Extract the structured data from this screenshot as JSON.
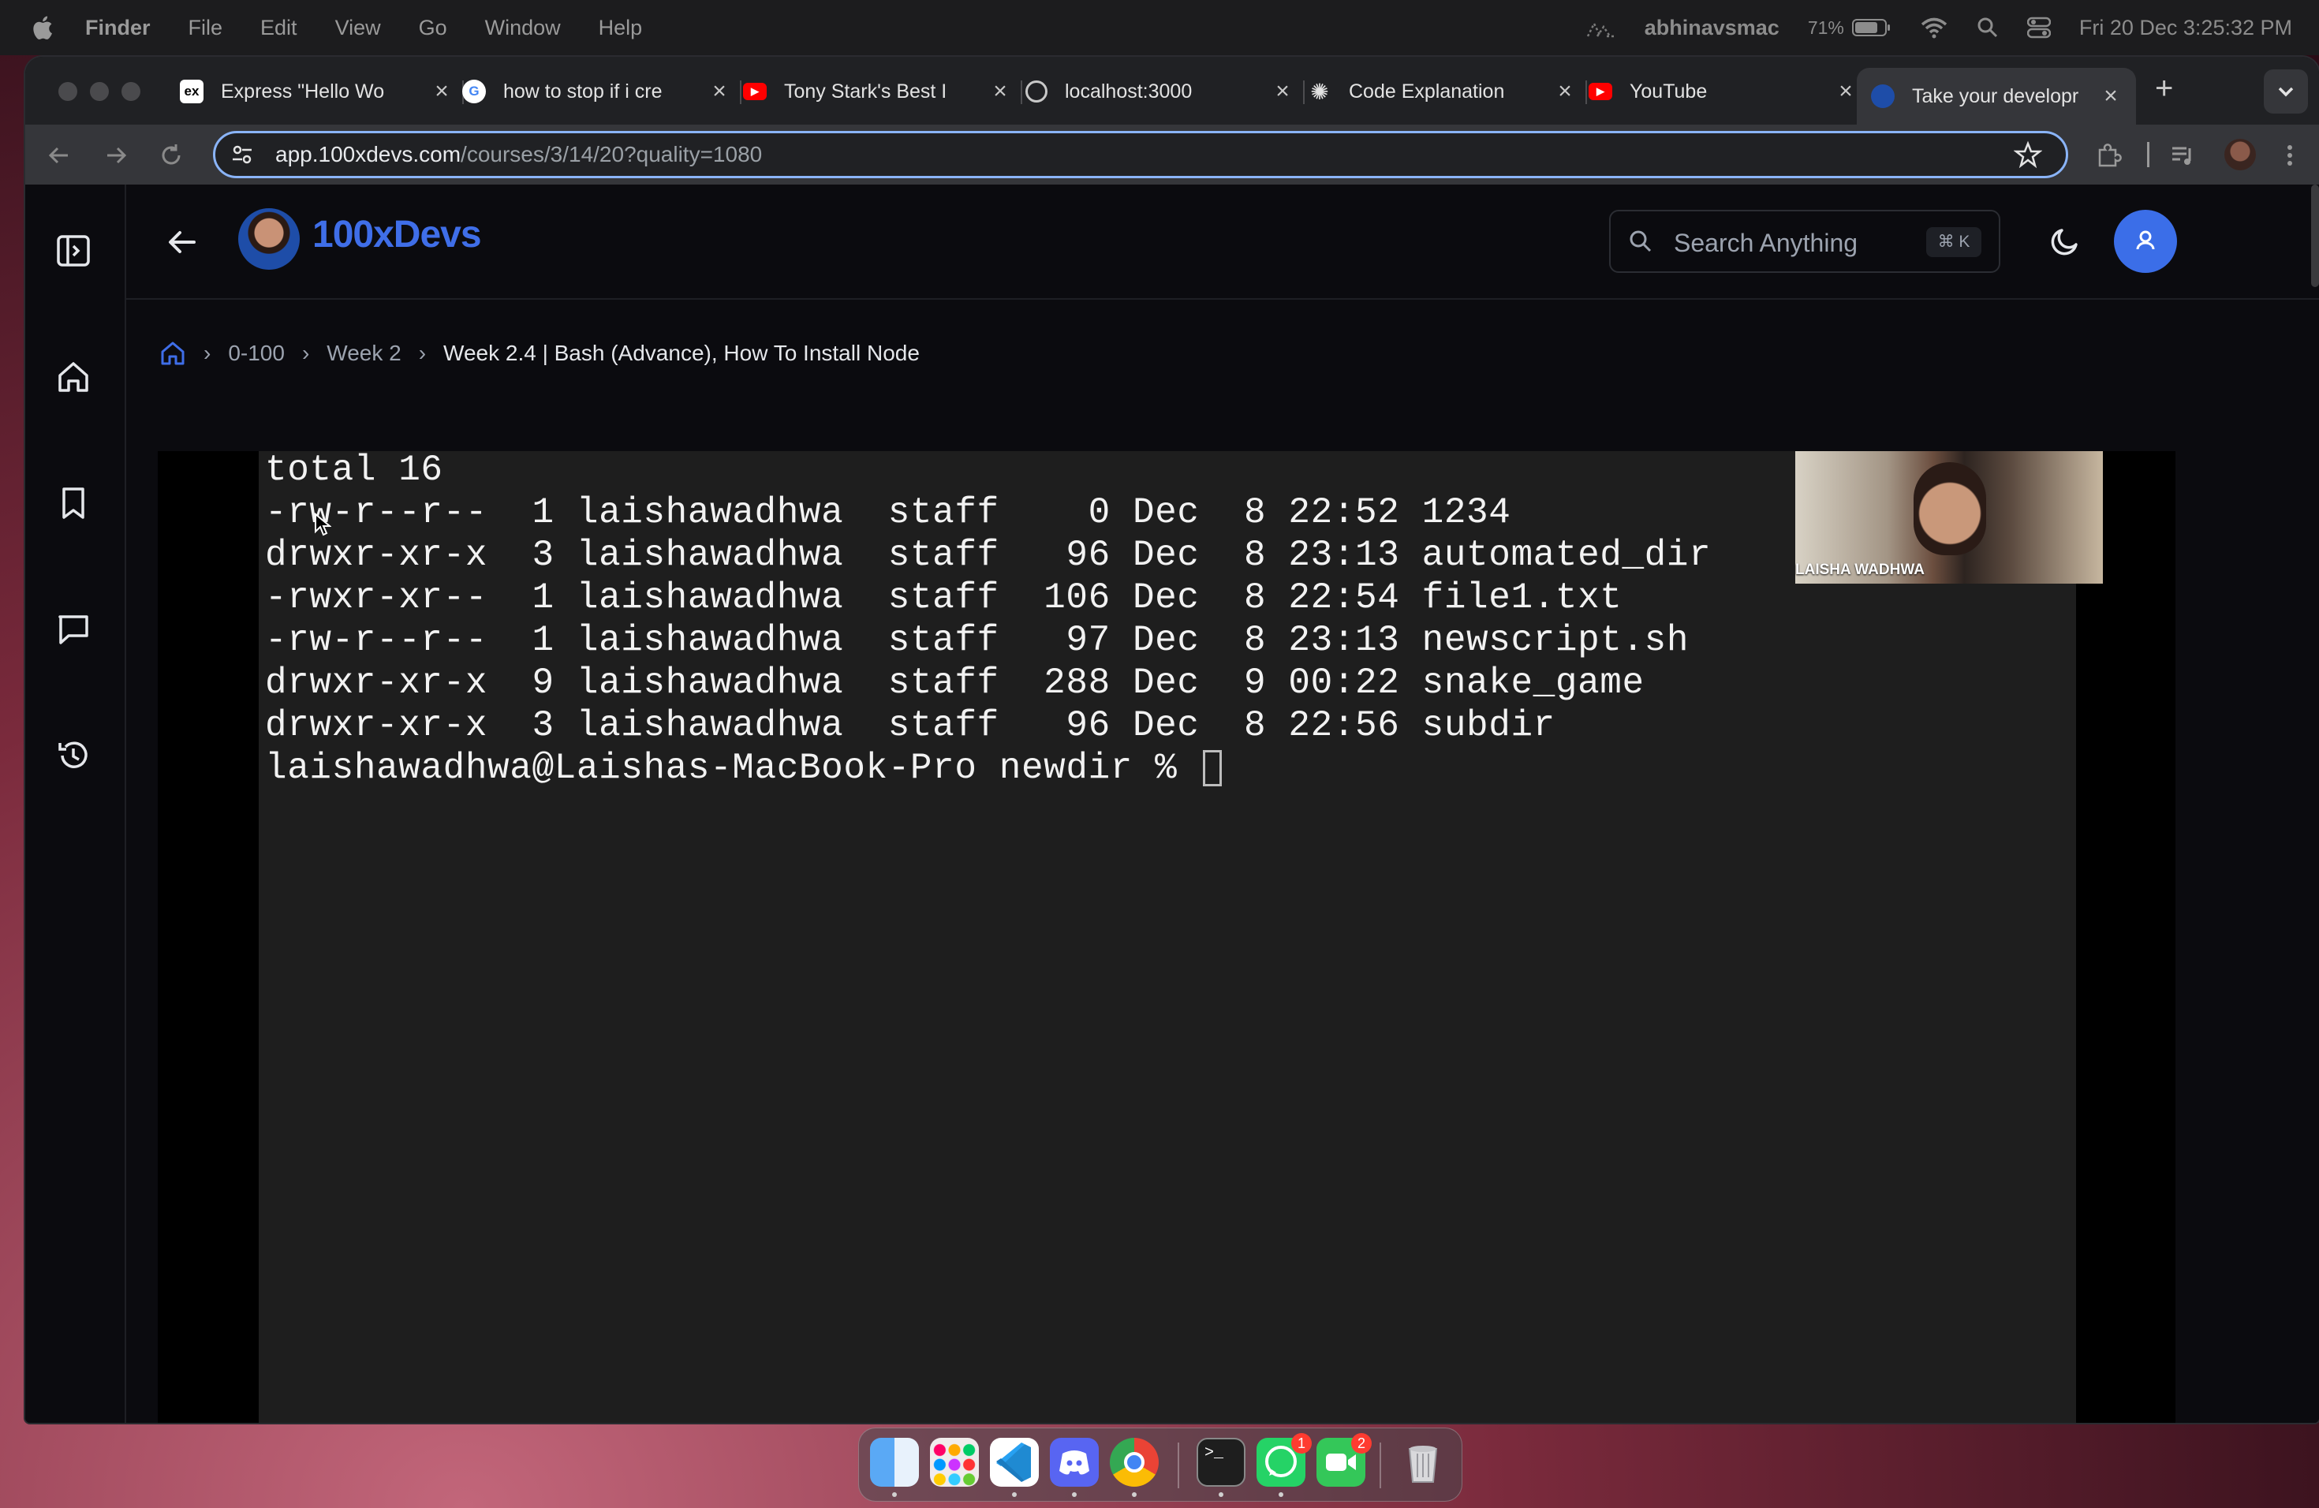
{
  "menubar": {
    "app_name": "Finder",
    "menus": [
      "File",
      "Edit",
      "View",
      "Go",
      "Window",
      "Help"
    ],
    "user": "abhinavsmac",
    "battery": "71%",
    "datetime": "Fri 20 Dec  3:25:32 PM"
  },
  "tabs": [
    {
      "title": "Express \"Hello Wo",
      "favicon": "express-icon",
      "active": false
    },
    {
      "title": "how to stop if i cre",
      "favicon": "google-icon",
      "active": false
    },
    {
      "title": "Tony Stark's Best I",
      "favicon": "youtube-icon",
      "active": false
    },
    {
      "title": "localhost:3000",
      "favicon": "globe-icon",
      "active": false
    },
    {
      "title": "Code Explanation",
      "favicon": "chatgpt-icon",
      "active": false
    },
    {
      "title": "YouTube",
      "favicon": "youtube-icon",
      "active": false
    },
    {
      "title": "Take your developr",
      "favicon": "100xdevs-avatar-icon",
      "active": true
    }
  ],
  "address_bar": {
    "url_host": "app.100xdevs.com",
    "url_path": "/courses/3/14/20?quality=1080"
  },
  "site": {
    "brand": "100xDevs",
    "search_placeholder": "Search Anything",
    "search_shortcut": "⌘ K"
  },
  "breadcrumb": {
    "items": [
      "0-100",
      "Week 2"
    ],
    "current": "Week 2.4 | Bash (Advance), How To Install Node"
  },
  "terminal": {
    "lines": [
      "total 16",
      "-rw-r--r--  1 laishawadhwa  staff    0 Dec  8 22:52 1234",
      "drwxr-xr-x  3 laishawadhwa  staff   96 Dec  8 23:13 automated_dir",
      "-rwxr-xr--  1 laishawadhwa  staff  106 Dec  8 22:54 file1.txt",
      "-rw-r--r--  1 laishawadhwa  staff   97 Dec  8 23:13 newscript.sh",
      "drwxr-xr-x  9 laishawadhwa  staff  288 Dec  9 00:22 snake_game",
      "drwxr-xr-x  3 laishawadhwa  staff   96 Dec  8 22:56 subdir"
    ],
    "prompt": "laishawadhwa@Laishas-MacBook-Pro newdir % "
  },
  "webcam": {
    "name": "LAISHA WADHWA"
  },
  "dock": {
    "apps": [
      "finder-icon",
      "launchpad-icon",
      "vscode-icon",
      "discord-icon",
      "chrome-icon",
      "terminal-icon",
      "whatsapp-icon",
      "facetime-icon",
      "trash-icon"
    ],
    "badges": {
      "whatsapp": "1",
      "facetime": "2"
    }
  }
}
